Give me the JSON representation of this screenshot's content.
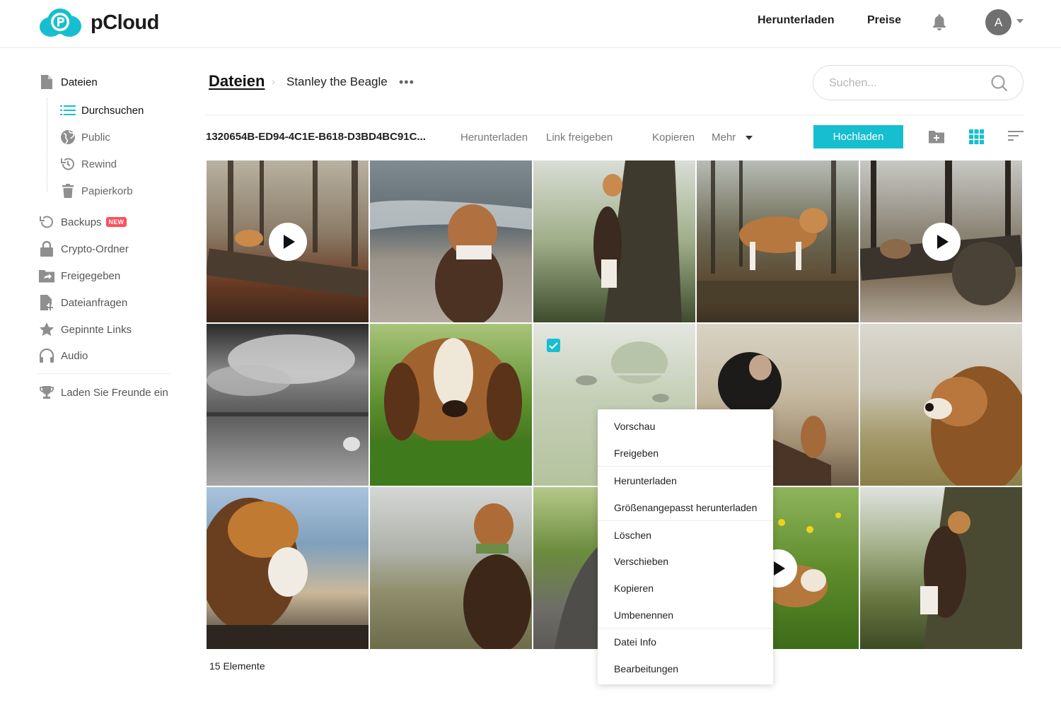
{
  "header": {
    "brand": "pCloud",
    "links": [
      "Herunterladen",
      "Preise"
    ],
    "avatar_initial": "A"
  },
  "sidebar": {
    "files": "Dateien",
    "sub_items": [
      "Durchsuchen",
      "Public",
      "Rewind",
      "Papierkorb"
    ],
    "backups": "Backups",
    "new_badge": "NEW",
    "items": [
      "Crypto-Ordner",
      "Freigegeben",
      "Dateianfragen",
      "Gepinnte Links",
      "Audio"
    ],
    "invite": "Laden Sie Freunde ein"
  },
  "breadcrumb": {
    "root": "Dateien",
    "separator": "›",
    "folder": "Stanley the Beagle",
    "more": "•••"
  },
  "search": {
    "placeholder": "Suchen..."
  },
  "toolbar": {
    "file_name": "1320654B-ED94-4C1E-B618-D3BD4BC91C...",
    "download": "Herunterladen",
    "share_link": "Link freigeben",
    "copy": "Kopieren",
    "more": "Mehr",
    "upload": "Hochladen"
  },
  "status": {
    "count": "15 Elemente"
  },
  "context_menu": {
    "items": [
      "Vorschau",
      "Freigeben",
      "Herunterladen",
      "Größenangepasst herunterladen",
      "Löschen",
      "Verschieben",
      "Kopieren",
      "Umbenennen",
      "Datei Info",
      "Bearbeitungen"
    ]
  },
  "colors": {
    "accent": "#17bed0",
    "badge": "#ff4d5a"
  }
}
